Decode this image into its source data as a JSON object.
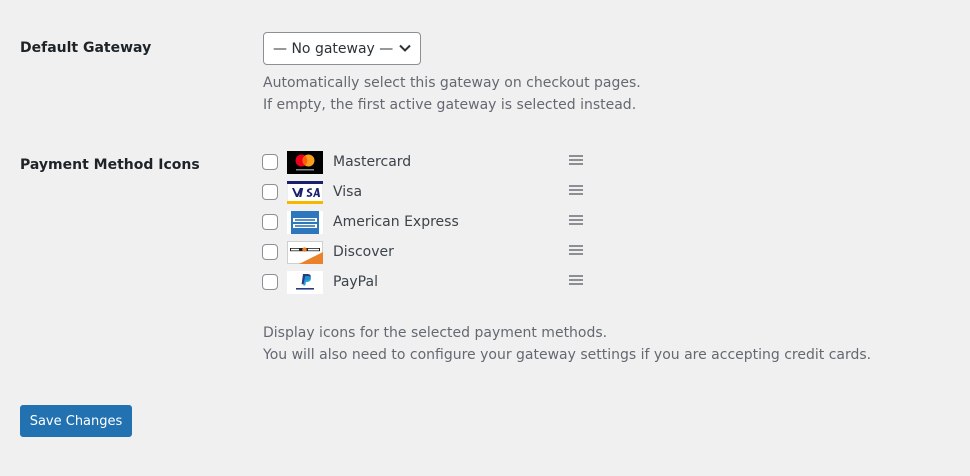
{
  "gateway": {
    "label": "Default Gateway",
    "selected": "— No gateway —",
    "description_line1": "Automatically select this gateway on checkout pages.",
    "description_line2": "If empty, the first active gateway is selected instead."
  },
  "icons": {
    "label": "Payment Method Icons",
    "methods": [
      {
        "name": "Mastercard",
        "checked": false,
        "icon": "mastercard-logo"
      },
      {
        "name": "Visa",
        "checked": false,
        "icon": "visa-logo"
      },
      {
        "name": "American Express",
        "checked": false,
        "icon": "amex-logo"
      },
      {
        "name": "Discover",
        "checked": false,
        "icon": "discover-logo"
      },
      {
        "name": "PayPal",
        "checked": false,
        "icon": "paypal-logo"
      }
    ],
    "description_line1": "Display icons for the selected payment methods.",
    "description_line2": "You will also need to configure your gateway settings if you are accepting credit cards."
  },
  "actions": {
    "save_label": "Save Changes"
  },
  "colors": {
    "background": "#f0f0f1",
    "primary_button": "#2271b1"
  }
}
